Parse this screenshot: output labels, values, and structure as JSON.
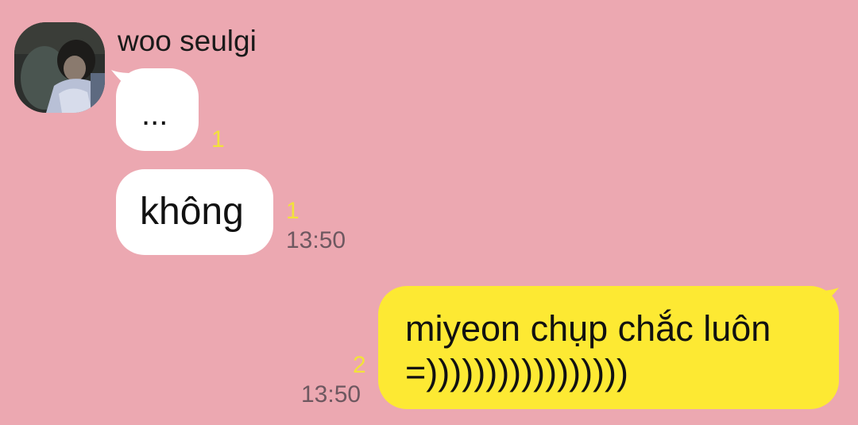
{
  "chat": {
    "background_color": "#eca8b1",
    "incoming_bubble_color": "#ffffff",
    "outgoing_bubble_color": "#fde933",
    "unread_color": "#f2e23a"
  },
  "sender": {
    "name": "woo seulgi",
    "avatar_icon": "profile-photo-avatar"
  },
  "messages": [
    {
      "direction": "incoming",
      "text": "...",
      "unread": "1",
      "time": ""
    },
    {
      "direction": "incoming",
      "text": "không",
      "unread": "1",
      "time": "13:50"
    },
    {
      "direction": "outgoing",
      "lines": [
        "miyeon chụp chắc luôn",
        "=)))))))))))))))))"
      ],
      "unread": "2",
      "time": "13:50"
    }
  ]
}
